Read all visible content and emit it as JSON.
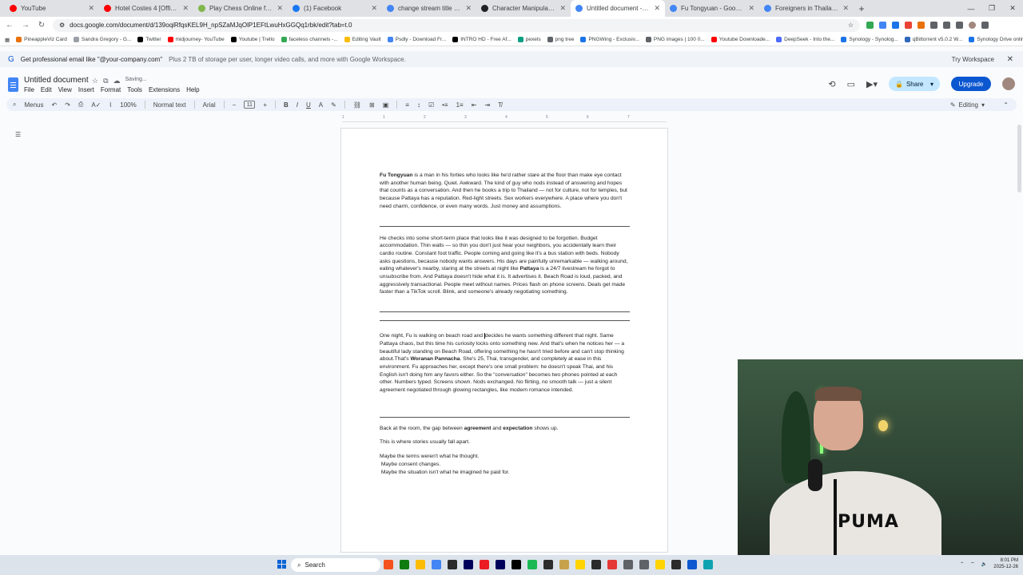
{
  "browser": {
    "tabs": [
      {
        "label": "YouTube",
        "color": "#ff0000",
        "active": false
      },
      {
        "label": "Hotel Costes 4 [Official Full",
        "color": "#ff0000",
        "active": false
      },
      {
        "label": "Play Chess Online for FREE - 2",
        "color": "#81b64c",
        "active": false
      },
      {
        "label": "(1) Facebook",
        "color": "#1877f2",
        "active": false
      },
      {
        "label": "change stream title kick - Goog",
        "color": "#4285f4",
        "active": false
      },
      {
        "label": "Character Manipulation - AI Im",
        "color": "#202124",
        "active": false
      },
      {
        "label": "Untitled document - Google Do",
        "color": "#4285f4",
        "active": true
      },
      {
        "label": "Fu Tongyuan - Google Search",
        "color": "#4285f4",
        "active": false
      },
      {
        "label": "Foreigners in Thailand Prison",
        "color": "#4285f4",
        "active": false
      }
    ],
    "url": "docs.google.com/document/d/139oqiRfqsKEL9H_npSZaMJqOlP1EFtLwuHxGGQq1rbk/edit?tab=t.0",
    "bookmarks": [
      {
        "label": "PineappleViz Card",
        "color": "#e8710a"
      },
      {
        "label": "Sandra Gregory - G...",
        "color": "#9aa0a6"
      },
      {
        "label": "Twitter",
        "color": "#000000"
      },
      {
        "label": "midjourney- YouTube",
        "color": "#ff0000"
      },
      {
        "label": "Youtube | Trello",
        "color": "#000000"
      },
      {
        "label": "faceless channels -...",
        "color": "#34a853"
      },
      {
        "label": "Editing Vault",
        "color": "#fbbc04"
      },
      {
        "label": "Psdly - Download Fr...",
        "color": "#4285f4"
      },
      {
        "label": "INTRO HD - Free Af...",
        "color": "#000000"
      },
      {
        "label": "pexels",
        "color": "#05a081"
      },
      {
        "label": "png tree",
        "color": "#5f6368"
      },
      {
        "label": "PNGWing - Exclusiv...",
        "color": "#1a73e8"
      },
      {
        "label": "PNG images | 100 0...",
        "color": "#5f6368"
      },
      {
        "label": "Youtube Downloade...",
        "color": "#ff0000"
      },
      {
        "label": "DeepSeek - Into the...",
        "color": "#4d6bfe"
      },
      {
        "label": "Synology - Synolog...",
        "color": "#1a73e8"
      },
      {
        "label": "qBittorrent v5.0.2 W...",
        "color": "#2f67ba"
      },
      {
        "label": "Synology Drive online",
        "color": "#1a73e8"
      }
    ]
  },
  "banner": {
    "text": "Get professional email like \"@your-company.com\"",
    "subtext": "Plus 2 TB of storage per user, longer video calls, and more with Google Workspace.",
    "action": "Try Workspace"
  },
  "doc": {
    "title": "Untitled document",
    "status": "Saving...",
    "menus": [
      "File",
      "Edit",
      "View",
      "Insert",
      "Format",
      "Tools",
      "Extensions",
      "Help"
    ],
    "share_label": "Share",
    "upgrade_label": "Upgrade",
    "toolbar": {
      "menus_label": "Menus",
      "zoom": "100%",
      "style": "Normal text",
      "font": "Arial",
      "font_size": "11",
      "mode": "Editing"
    },
    "ruler_marks": [
      "1",
      "1",
      "2",
      "3",
      "4",
      "5",
      "6",
      "7"
    ]
  },
  "content": {
    "p1_name": "Fu Tongyuan",
    "p1_rest": " is a man in his forties who looks like he'd rather stare at the floor than make eye contact with another human being. Quiet. Awkward. The kind of guy who nods instead of answering and hopes that counts as a conversation. And then he books a trip to Thailand — not for culture, not for temples, but because Pattaya has a reputation. Red-light streets. Sex workers everywhere. A place where you don't need charm, confidence, or even many words. Just money and assumptions.",
    "p2_a": "He checks into some short-term place that looks like it was designed to be forgotten. Budget accommodation. Thin walls — so thin you don't just hear your neighbors, you accidentally learn their cardio routine. Constant foot traffic. People coming and going like it's a bus station with beds. Nobody asks questions, because nobody wants answers. His days are painfully unremarkable — walking around, eating whatever's nearby, staring at the streets at night like ",
    "p2_bold": "Pattaya",
    "p2_b": " is a 24/7 livestream he forgot to unsubscribe from. And Pattaya doesn't hide what it is. It advertises it. Beach Road is loud, packed, and aggressively transactional. People meet without names. Prices flash on phone screens. Deals get made faster than a TikTok scroll. Blink, and someone's already negotiating something.",
    "p3_a": "One night, Fu is walking on beach road and ",
    "p3_b": "decides he wants something different that night. Same Pattaya chaos, but this time his curiosity locks onto something new. And that's when he notices her — a beautiful lady standing on Beach Road, offering something he hasn't tried before and can't stop thinking about.That's ",
    "p3_bold": "Woranan Pannacha",
    "p3_c": ". She's 25, Thai, transgender, and completely at ease in this environment. Fu approaches her, except there's one small problem: he doesn't speak Thai, and his English isn't doing him any favors either. So the \"conversation\" becomes two phones pointed at each other. Numbers typed. Screens shown. Nods exchanged. No flirting, no smooth talk — just a silent agreement negotiated through glowing rectangles, like modern romance intended.",
    "p4_a": "Back at the room, the gap between ",
    "p4_bold1": "agreement",
    "p4_mid": " and ",
    "p4_bold2": "expectation",
    "p4_b": " shows up.",
    "p5": "This is where stories usually fall apart.",
    "p6_l1": "Maybe the terms weren't what he thought.",
    "p6_l2": " Maybe consent changes.",
    "p6_l3": " Maybe the situation isn't what he imagined he paid for."
  },
  "taskbar": {
    "search_placeholder": "Search",
    "time": "8:01 PM",
    "date": "2025-12-26"
  }
}
